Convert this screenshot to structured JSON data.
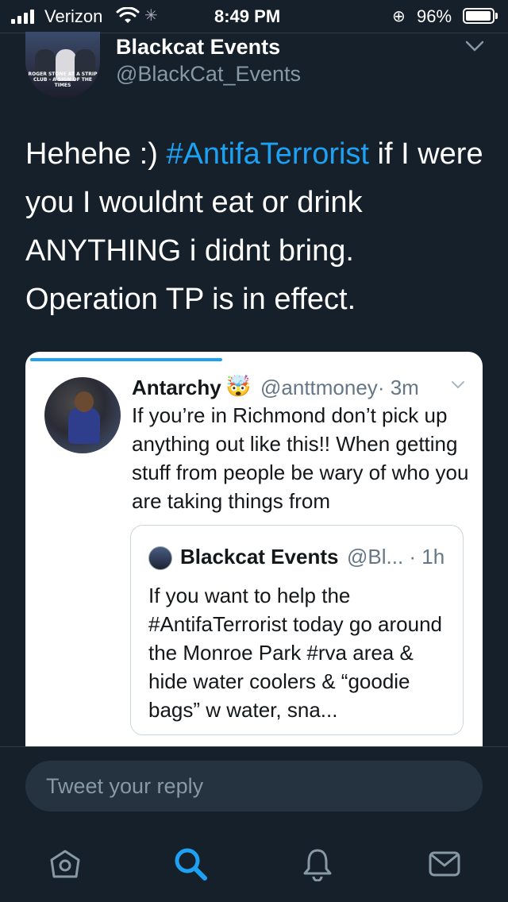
{
  "status_bar": {
    "carrier": "Verizon",
    "time": "8:49 PM",
    "battery_percent": "96%",
    "battery_level": 0.96
  },
  "tweet": {
    "author_name": "Blackcat Events",
    "author_handle": "@BlackCat_Events",
    "avatar_caption": "ROGER STONE AT A STRIP CLUB - A SIGN OF THE TIMES",
    "text_before_hashtag": "Hehehe :) ",
    "hashtag": "#AntifaTerrorist",
    "text_after_hashtag": " if I were you I wouldnt eat or drink ANYTHING i didnt bring. Operation TP is in effect."
  },
  "quoted_tweet": {
    "author_name": "Antarchy",
    "author_emoji": "🤯",
    "author_handle": "@anttmoney",
    "time": "· 3m",
    "text": "If you’re in Richmond don’t pick up anything out like this!! When getting stuff from people be wary of who you are taking things from",
    "nested": {
      "author_name": "Blackcat Events",
      "author_handle": "@Bl... · 1h",
      "text": "If you want to help the #AntifaTerrorist today go around the Monroe Park #rva area & hide water coolers & “goodie bags” w water, sna..."
    }
  },
  "reply": {
    "placeholder": "Tweet your reply"
  },
  "tabs": [
    "home-icon",
    "search-icon",
    "notifications-icon",
    "messages-icon"
  ],
  "colors": {
    "background": "#15202b",
    "accent": "#1da1f2",
    "secondary_text": "#8899a6"
  }
}
